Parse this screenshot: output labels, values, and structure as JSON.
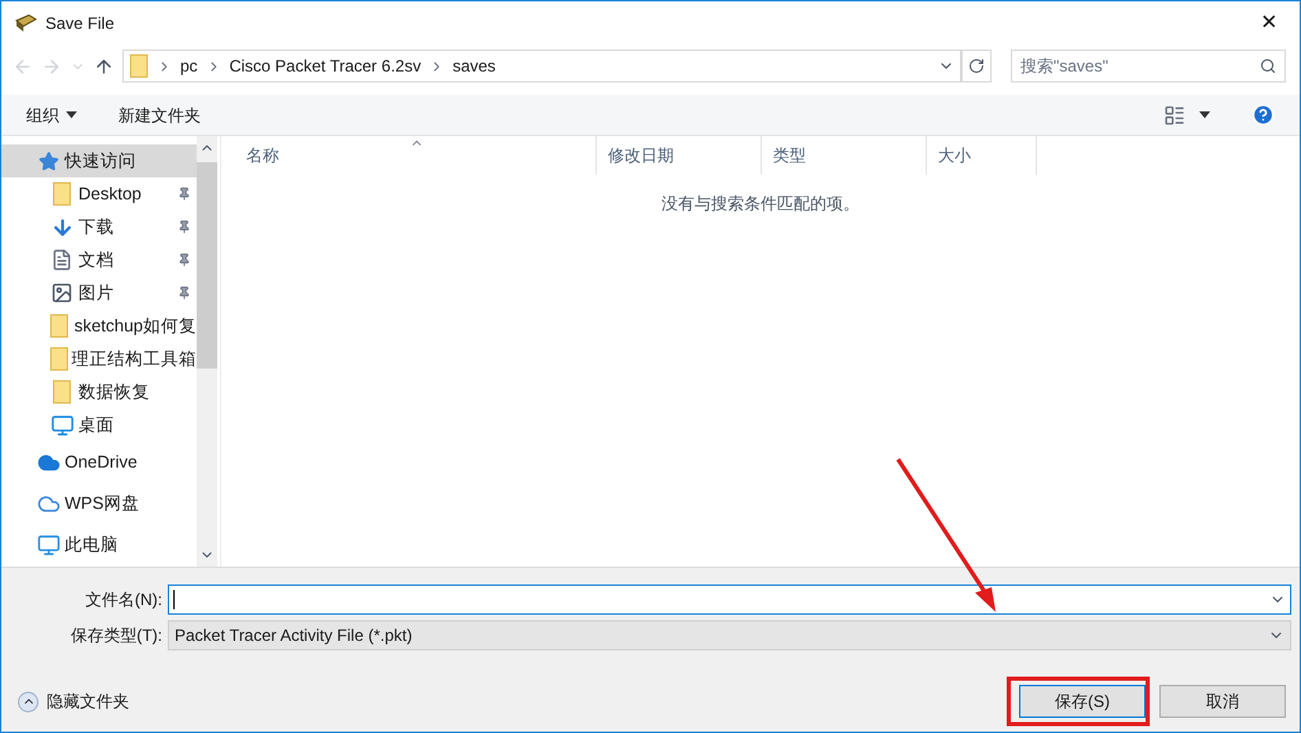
{
  "window": {
    "title": "Save File",
    "close": "✕"
  },
  "address": {
    "crumbs": [
      "pc",
      "Cisco Packet Tracer 6.2sv",
      "saves"
    ]
  },
  "search": {
    "placeholder": "搜索\"saves\""
  },
  "toolbar": {
    "organize": "组织",
    "new_folder": "新建文件夹"
  },
  "sidebar": {
    "items": [
      {
        "kind": "star",
        "label": "快速访问",
        "selected": true,
        "pinned": false,
        "indent": false
      },
      {
        "kind": "folder",
        "label": "Desktop",
        "selected": false,
        "pinned": true,
        "indent": true
      },
      {
        "kind": "download",
        "label": "下载",
        "selected": false,
        "pinned": true,
        "indent": true
      },
      {
        "kind": "document",
        "label": "文档",
        "selected": false,
        "pinned": true,
        "indent": true
      },
      {
        "kind": "image",
        "label": "图片",
        "selected": false,
        "pinned": true,
        "indent": true
      },
      {
        "kind": "folder",
        "label": "sketchup如何复",
        "selected": false,
        "pinned": false,
        "indent": true
      },
      {
        "kind": "folder",
        "label": "理正结构工具箱",
        "selected": false,
        "pinned": false,
        "indent": true
      },
      {
        "kind": "folder",
        "label": "数据恢复",
        "selected": false,
        "pinned": false,
        "indent": true
      },
      {
        "kind": "desktop",
        "label": "桌面",
        "selected": false,
        "pinned": false,
        "indent": true
      },
      {
        "kind": "cloud",
        "label": "OneDrive",
        "selected": false,
        "pinned": false,
        "indent": false
      },
      {
        "kind": "cloud-outline",
        "label": "WPS网盘",
        "selected": false,
        "pinned": false,
        "indent": false
      },
      {
        "kind": "monitor",
        "label": "此电脑",
        "selected": false,
        "pinned": false,
        "indent": false
      }
    ]
  },
  "table": {
    "columns": [
      "名称",
      "修改日期",
      "类型",
      "大小"
    ],
    "empty_message": "没有与搜索条件匹配的项。"
  },
  "form": {
    "filename_label": "文件名(N):",
    "type_label": "保存类型(T):",
    "type_value": "Packet Tracer Activity File (*.pkt)"
  },
  "footer": {
    "hide_folders": "隐藏文件夹",
    "buttons": [
      {
        "label": "保存(S)",
        "default": true
      },
      {
        "label": "取消",
        "default": false
      }
    ]
  }
}
